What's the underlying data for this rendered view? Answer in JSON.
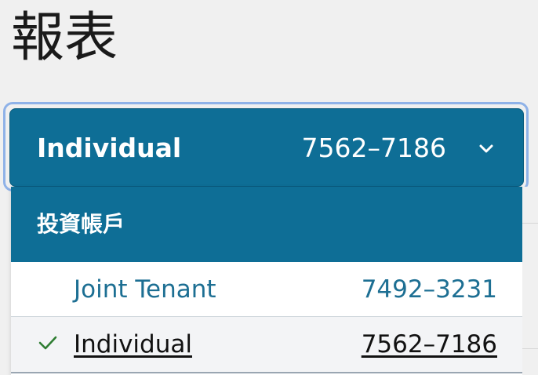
{
  "page": {
    "title": "報表"
  },
  "account_selector": {
    "selected_label": "Individual",
    "selected_number": "7562–7186",
    "chevron_icon": "chevron-down-icon",
    "background_color": "#0e6e96",
    "focus_ring_color": "#8fb2e8"
  },
  "dropdown": {
    "header": "投資帳戶",
    "options": [
      {
        "label": "Joint Tenant",
        "number": "7492–3231",
        "selected": false
      },
      {
        "label": "Individual",
        "number": "7562–7186",
        "selected": true
      }
    ],
    "check_icon": "checkmark-icon",
    "check_color": "#2e7d32",
    "link_color": "#1d6f93"
  }
}
